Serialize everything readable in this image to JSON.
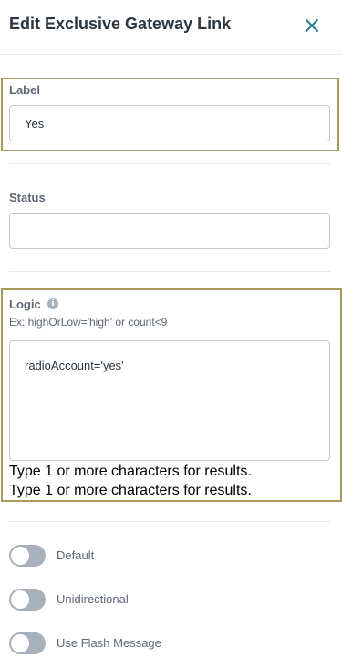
{
  "header": {
    "title": "Edit Exclusive Gateway Link",
    "close_icon": "close-icon"
  },
  "label_field": {
    "label": "Label",
    "value": "Yes"
  },
  "status_field": {
    "label": "Status",
    "value": ""
  },
  "logic_field": {
    "label": "Logic",
    "info_icon": "info-icon",
    "hint": "Ex: highOrLow='high' or count<9",
    "value": "radioAccount='yes'",
    "results": [
      "Type 1 or more characters for results.",
      "Type 1 or more characters for results."
    ]
  },
  "toggles": [
    {
      "label": "Default",
      "on": false
    },
    {
      "label": "Unidirectional",
      "on": false
    },
    {
      "label": "Use Flash Message",
      "on": false
    }
  ],
  "colors": {
    "accent": "#2c7a93",
    "highlight": "#a89a5b",
    "toggle_off": "#a6b1bc"
  }
}
